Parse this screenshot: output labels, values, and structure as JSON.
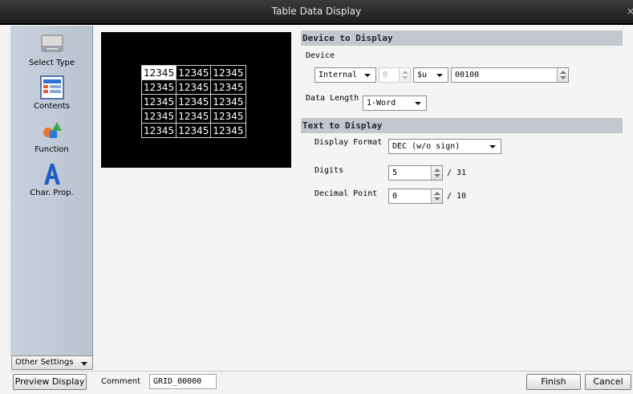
{
  "window": {
    "title": "Table Data Display",
    "close_glyph": "×"
  },
  "sidebar": {
    "items": [
      {
        "label": "Select Type",
        "icon": "select-type-icon"
      },
      {
        "label": "Contents",
        "icon": "contents-icon"
      },
      {
        "label": "Function",
        "icon": "function-icon"
      },
      {
        "label": "Char. Prop.",
        "icon": "char-prop-icon"
      }
    ],
    "other_settings": "Other Settings"
  },
  "preview": {
    "rows": [
      [
        "12345",
        "12345",
        "12345"
      ],
      [
        "12345",
        "12345",
        "12345"
      ],
      [
        "12345",
        "12345",
        "12345"
      ],
      [
        "12345",
        "12345",
        "12345"
      ],
      [
        "12345",
        "12345",
        "12345"
      ]
    ]
  },
  "device_to_display": {
    "header": "Device to Display",
    "device_label": "Device",
    "device_type": "Internal",
    "station": "0",
    "address_prefix": "$u",
    "address": "00100",
    "data_length_label": "Data Length",
    "data_length": "1-Word"
  },
  "text_to_display": {
    "header": "Text to Display",
    "display_format_label": "Display Format",
    "display_format": "DEC (w/o sign)",
    "digits_label": "Digits",
    "digits": "5",
    "digits_max": "/ 31",
    "decimal_point_label": "Decimal Point",
    "decimal_point": "0",
    "decimal_point_max": "/ 10"
  },
  "bottom": {
    "preview_display": "Preview Display",
    "comment_label": "Comment",
    "comment_value": "GRID_00000",
    "finish": "Finish",
    "cancel": "Cancel"
  },
  "colors": {
    "titlebar": "#2c2c2c",
    "sidebar": "#c0c9d6",
    "section_header": "#c3c7ce",
    "preview_bg": "#000000"
  }
}
